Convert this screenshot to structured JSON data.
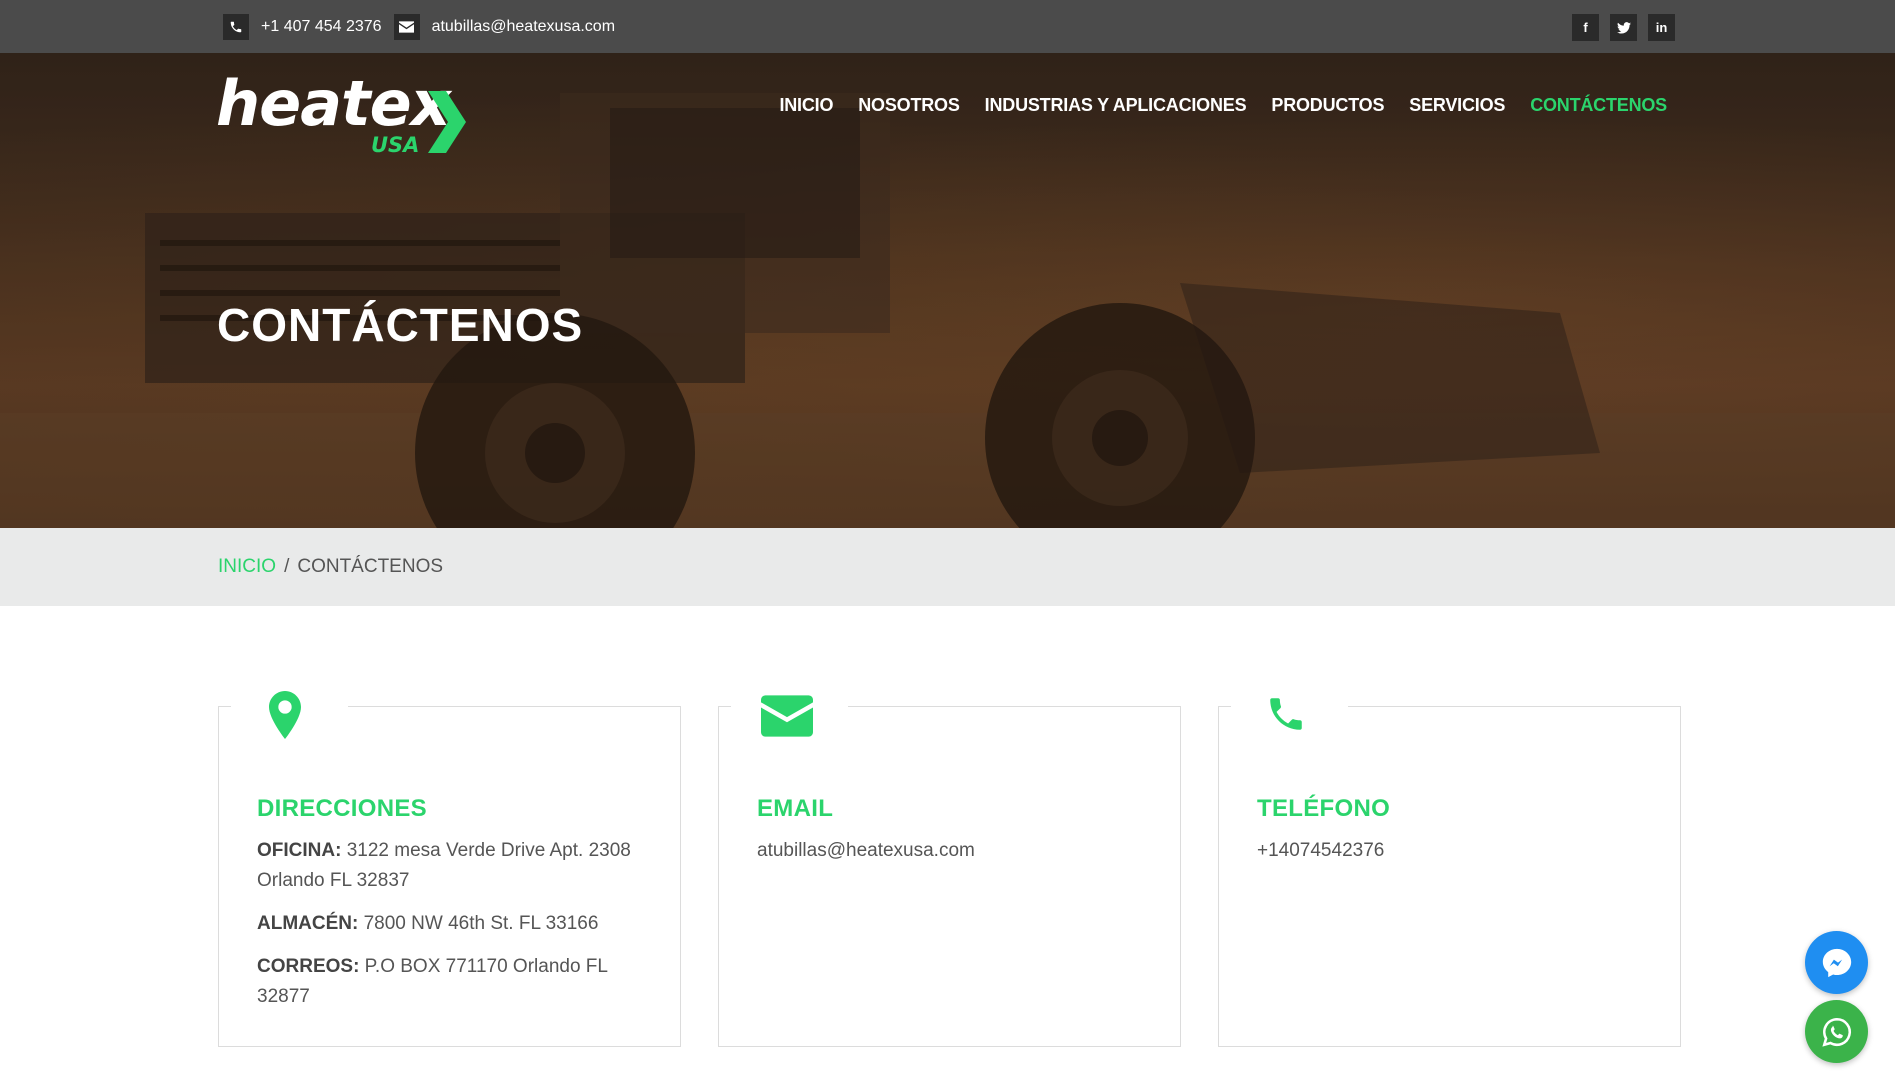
{
  "topbar": {
    "phone": "+1 407 454 2376",
    "email": "atubillas@heatexusa.com",
    "socials": [
      {
        "name": "facebook",
        "glyph": "f"
      },
      {
        "name": "twitter",
        "glyph": "t"
      },
      {
        "name": "linkedin",
        "glyph": "in"
      }
    ]
  },
  "brand": {
    "word": "heatex",
    "sub": "USA",
    "accent_color": "#2bd46c"
  },
  "nav": {
    "items": [
      {
        "label": "INICIO",
        "active": false
      },
      {
        "label": "NOSOTROS",
        "active": false
      },
      {
        "label": "INDUSTRIAS Y APLICACIONES",
        "active": false
      },
      {
        "label": "PRODUCTOS",
        "active": false
      },
      {
        "label": "SERVICIOS",
        "active": false
      },
      {
        "label": "CONTÁCTENOS",
        "active": true
      }
    ]
  },
  "hero": {
    "title": "CONTÁCTENOS"
  },
  "breadcrumb": {
    "home": "INICIO",
    "separator": "/",
    "current": "CONTÁCTENOS"
  },
  "cards": {
    "address": {
      "icon": "map-pin-icon",
      "title": "DIRECCIONES",
      "office_label": "OFICINA:",
      "office_value": " 3122 mesa Verde Drive Apt. 2308 Orlando FL 32837",
      "warehouse_label": "ALMACÉN:",
      "warehouse_value": " 7800 NW 46th St. FL 33166",
      "mail_label": "CORREOS:",
      "mail_value": " P.O BOX 771170 Orlando FL 32877"
    },
    "email": {
      "icon": "envelope-icon",
      "title": "EMAIL",
      "value": "atubillas@heatexusa.com"
    },
    "phone": {
      "icon": "phone-icon",
      "title": "TELÉFONO",
      "value": "+14074542376"
    }
  },
  "floating": {
    "messenger_color": "#1f8ef1",
    "whatsapp_color": "#3bb34a"
  }
}
